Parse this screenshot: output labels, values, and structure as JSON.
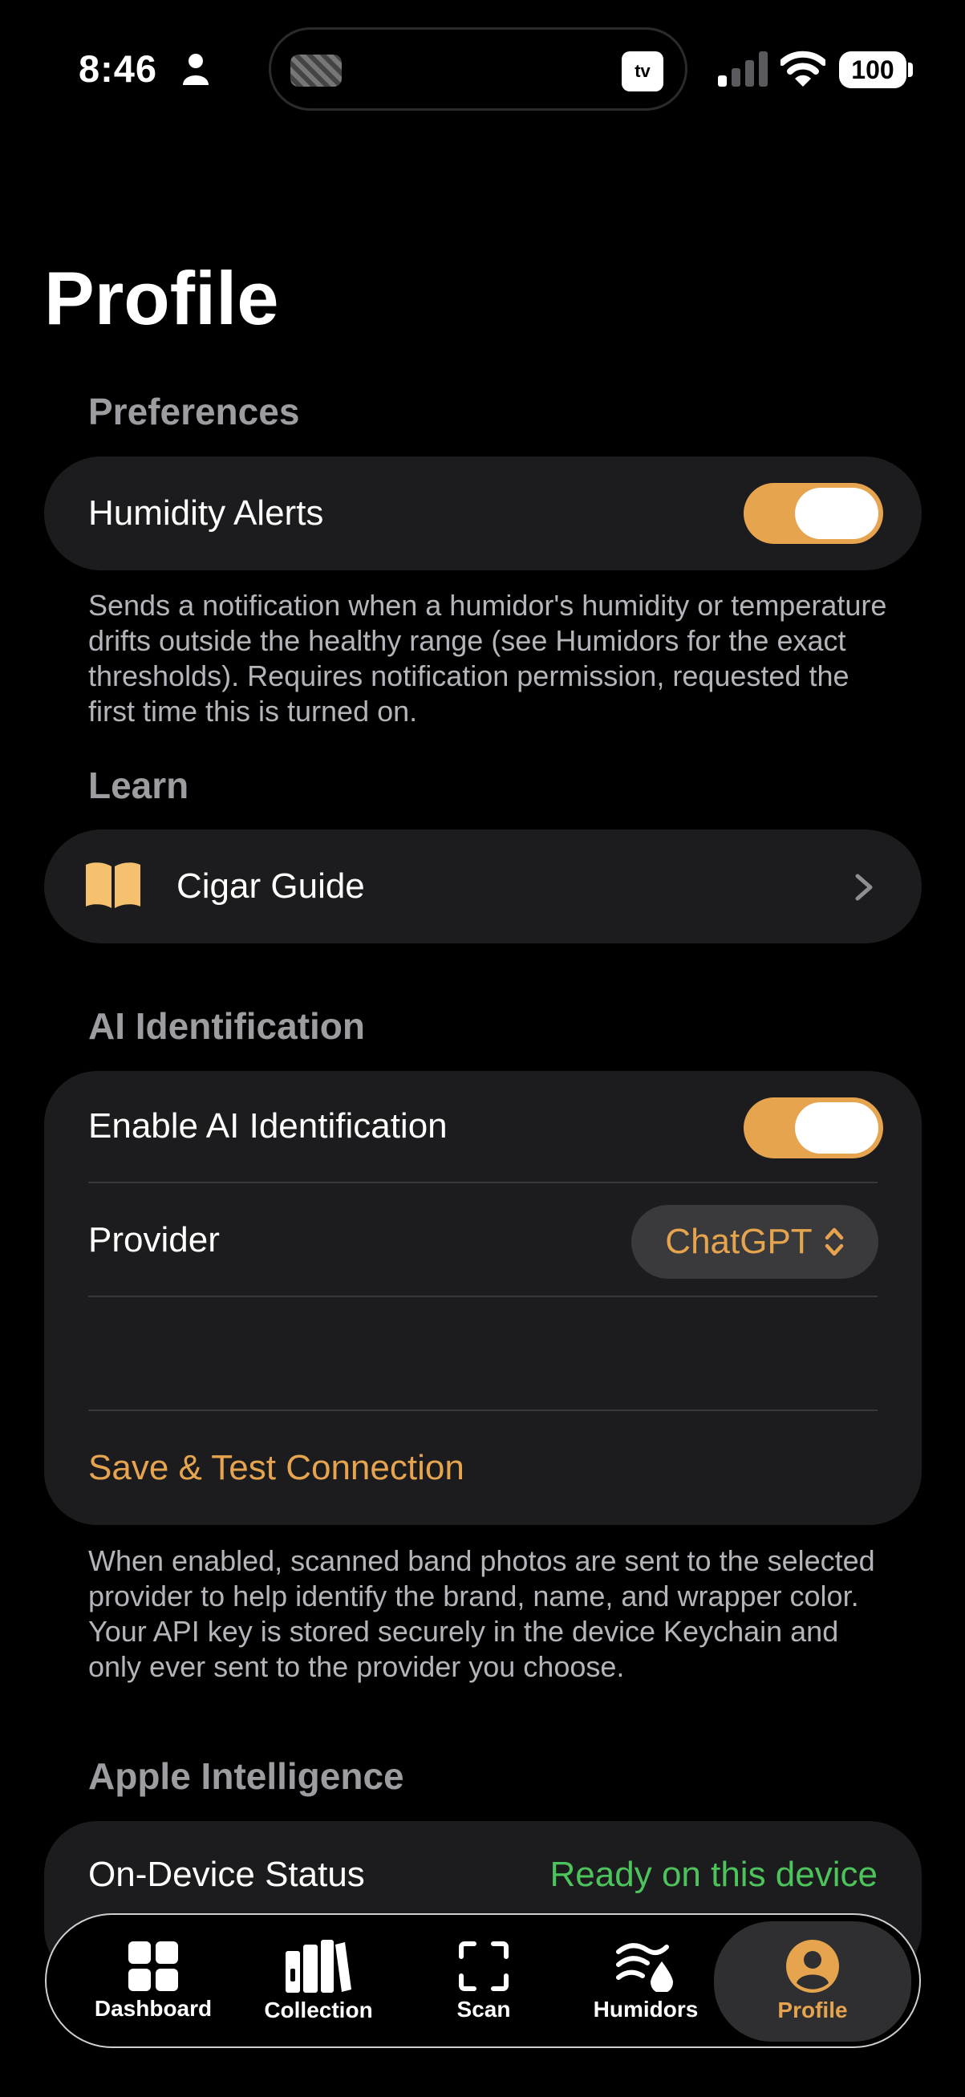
{
  "status_bar": {
    "time": "8:46",
    "tv_badge": "tv",
    "battery": "100"
  },
  "title": "Profile",
  "preferences": {
    "header": "Preferences",
    "humidity_alerts_label": "Humidity Alerts",
    "humidity_alerts_on": true,
    "footnote": "Sends a notification when a humidor's humidity or temperature drifts outside the healthy range (see Humidors for the exact thresholds). Requires notification permission, requested the first time this is turned on."
  },
  "learn": {
    "header": "Learn",
    "guide_label": "Cigar Guide",
    "guide_icon": "book-icon"
  },
  "ai": {
    "header": "AI Identification",
    "enable_label": "Enable AI Identification",
    "enable_on": true,
    "provider_label": "Provider",
    "provider_value": "ChatGPT",
    "save_label": "Save & Test Connection",
    "footnote": "When enabled, scanned band photos are sent to the selected provider to help identify the brand, name, and wrapper color. Your API key is stored securely in the device Keychain and only ever sent to the provider you choose."
  },
  "apple_intelligence": {
    "header": "Apple Intelligence",
    "status_label": "On-Device Status",
    "status_value": "Ready on this device"
  },
  "tabs": [
    {
      "label": "Dashboard",
      "icon": "grid-icon"
    },
    {
      "label": "Collection",
      "icon": "books-icon"
    },
    {
      "label": "Scan",
      "icon": "scan-icon"
    },
    {
      "label": "Humidors",
      "icon": "humidity-icon"
    },
    {
      "label": "Profile",
      "icon": "person-circle-icon",
      "active": true
    }
  ],
  "colors": {
    "accent": "#e6a44e",
    "card": "#1c1c1e",
    "status_green": "#4cc35b",
    "secondary_text": "#9c9ca1"
  }
}
